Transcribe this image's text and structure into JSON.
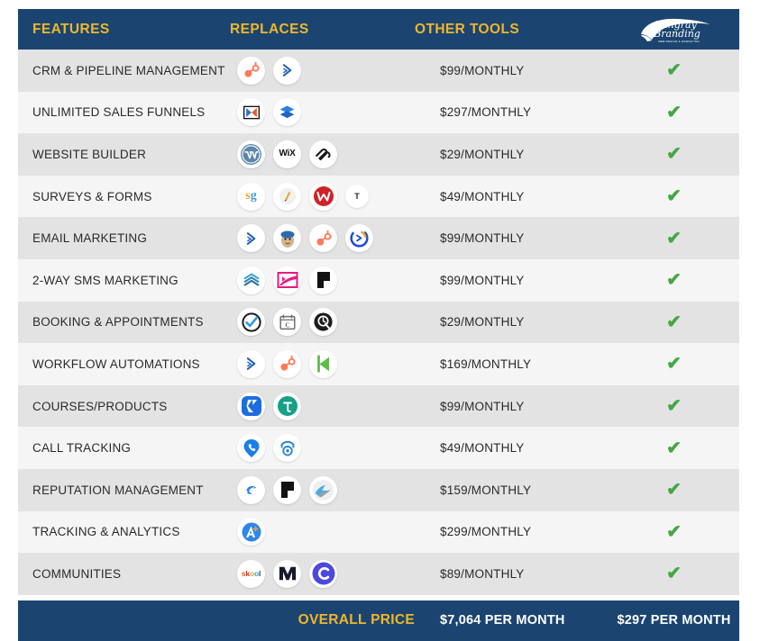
{
  "brand": {
    "logo_name": "Stingray Branding",
    "logo_line1": "Stingray",
    "logo_line2": "Branding",
    "logo_tagline": "WEB DESIGN & MARKETING",
    "navy": "#1b4570",
    "gold": "#f0b62b",
    "check_green": "#43a843"
  },
  "header": {
    "col_features": "FEATURES",
    "col_replaces": "REPLACES",
    "col_other_tools": "OTHER TOOLS"
  },
  "rows": [
    {
      "feature": "CRM & PIPELINE MANAGEMENT",
      "price": "$99/MONTHLY",
      "included": "✔",
      "tools": [
        "hubspot-icon",
        "pipedrive-icon"
      ]
    },
    {
      "feature": "UNLIMITED SALES FUNNELS",
      "price": "$297/MONTHLY",
      "included": "✔",
      "tools": [
        "clickfunnels-icon",
        "leadpages-icon"
      ]
    },
    {
      "feature": "WEBSITE BUILDER",
      "price": "$29/MONTHLY",
      "included": "✔",
      "tools": [
        "wordpress-icon",
        "wix-icon",
        "squarespace-icon"
      ]
    },
    {
      "feature": "SURVEYS & FORMS",
      "price": "$49/MONTHLY",
      "included": "✔",
      "tools": [
        "surveygizmo-icon",
        "jotform-icon",
        "wufoo-icon",
        "typeform-icon"
      ]
    },
    {
      "feature": "EMAIL MARKETING",
      "price": "$99/MONTHLY",
      "included": "✔",
      "tools": [
        "pipedrive-icon",
        "mailchimp-icon",
        "hubspot-icon",
        "activecampaign-icon"
      ]
    },
    {
      "feature": "2-WAY SMS MARKETING",
      "price": "$99/MONTHLY",
      "included": "✔",
      "tools": [
        "simpletexting-icon",
        "eztexting-icon",
        "podium-icon"
      ]
    },
    {
      "feature": "BOOKING & APPOINTMENTS",
      "price": "$29/MONTHLY",
      "included": "✔",
      "tools": [
        "calendly-icon",
        "acuity-icon",
        "setmore-icon"
      ]
    },
    {
      "feature": "WORKFLOW AUTOMATIONS",
      "price": "$169/MONTHLY",
      "included": "✔",
      "tools": [
        "pipedrive-icon",
        "hubspot-icon",
        "keap-icon"
      ]
    },
    {
      "feature": "COURSES/PRODUCTS",
      "price": "$99/MONTHLY",
      "included": "✔",
      "tools": [
        "kajabi-icon",
        "teachable-icon"
      ]
    },
    {
      "feature": "CALL TRACKING",
      "price": "$49/MONTHLY",
      "included": "✔",
      "tools": [
        "callrail-icon",
        "calltrackingmetrics-icon"
      ]
    },
    {
      "feature": "REPUTATION MANAGEMENT",
      "price": "$159/MONTHLY",
      "included": "✔",
      "tools": [
        "birdeye-icon",
        "podium-icon",
        "reputation-icon"
      ]
    },
    {
      "feature": "TRACKING & ANALYTICS",
      "price": "$299/MONTHLY",
      "included": "✔",
      "tools": [
        "google-analytics-icon"
      ]
    },
    {
      "feature": "COMMUNITIES",
      "price": "$89/MONTHLY",
      "included": "✔",
      "tools": [
        "skool-icon",
        "mighty-networks-icon",
        "circle-icon"
      ]
    }
  ],
  "footer": {
    "label": "OVERALL PRICE",
    "other_tools_total": "$7,064 PER MONTH",
    "our_total": "$297 PER MONTH"
  }
}
